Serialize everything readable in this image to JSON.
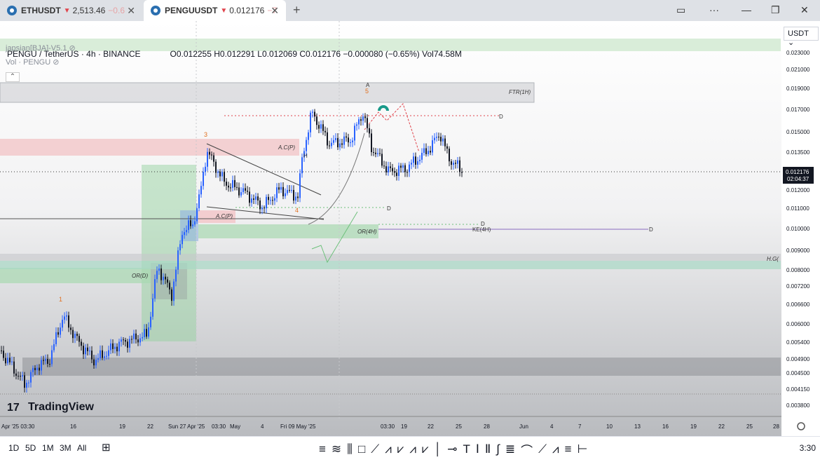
{
  "tabs": [
    {
      "symbol": "ETHUSDT",
      "arrow": "▼",
      "price": "2,513.46",
      "change": "−0.6"
    },
    {
      "symbol": "PENGUUSDT",
      "arrow": "▼",
      "price": "0.012176",
      "change": "−7"
    }
  ],
  "legend": {
    "title": "PENGU / TetherUS · 4h · BINANCE",
    "ohlc": "O0.012255 H0.012291 L0.012069 C0.012176 −0.000080 (−0.65%) Vol74.58M"
  },
  "indicators": [
    "japsian[BJA]-V5.1",
    "Vol · PENGU"
  ],
  "currency": "USDT",
  "price_axis": [
    "0.023000",
    "0.021000",
    "0.019000",
    "0.017000",
    "0.015000",
    "0.013500",
    "0.012000",
    "0.011000",
    "0.010000",
    "0.009000",
    "0.008000",
    "0.007200",
    "0.006600",
    "0.006000",
    "0.005400",
    "0.004900",
    "0.004500",
    "0.004150",
    "0.003800",
    "0.003500"
  ],
  "current_price": {
    "price": "0.012176",
    "countdown": "02:04:37"
  },
  "time_axis": [
    {
      "label": "Apr '25 03:30"
    },
    {
      "label": "16"
    },
    {
      "label": "19"
    },
    {
      "label": "22"
    },
    {
      "label": "Sun 27 Apr '25"
    },
    {
      "label": "03:30"
    },
    {
      "label": "May"
    },
    {
      "label": "4"
    },
    {
      "label": "Fri 09 May '25"
    },
    {
      "label": "03:30"
    },
    {
      "label": "19"
    },
    {
      "label": "22"
    },
    {
      "label": "25"
    },
    {
      "label": "28"
    },
    {
      "label": "Jun"
    },
    {
      "label": "4"
    },
    {
      "label": "7"
    },
    {
      "label": "10"
    },
    {
      "label": "13"
    },
    {
      "label": "16"
    },
    {
      "label": "19"
    },
    {
      "label": "22"
    },
    {
      "label": "25"
    },
    {
      "label": "28"
    }
  ],
  "annotations": {
    "ftr": "FTR(1H)",
    "acp_top": "A.C(P)",
    "acp_low": "A.C(P)",
    "or4h": "OR(4H)",
    "ke4h": "KE(4H)",
    "ord": "OR(D)",
    "hg": "H.G(",
    "wave1": "1",
    "wave3": "3",
    "wave4": "4",
    "wave5": "5",
    "waveA": "A",
    "d1": "D",
    "d2": "D",
    "d3": "D",
    "d4": "D",
    "h": "H"
  },
  "watermark": "TradingView",
  "timeframes": [
    "1D",
    "5D",
    "1M",
    "3M",
    "All"
  ],
  "clock": "3:30",
  "colors": {
    "up": "#2962ff",
    "down": "#131722",
    "accent_red": "#e0444c"
  }
}
